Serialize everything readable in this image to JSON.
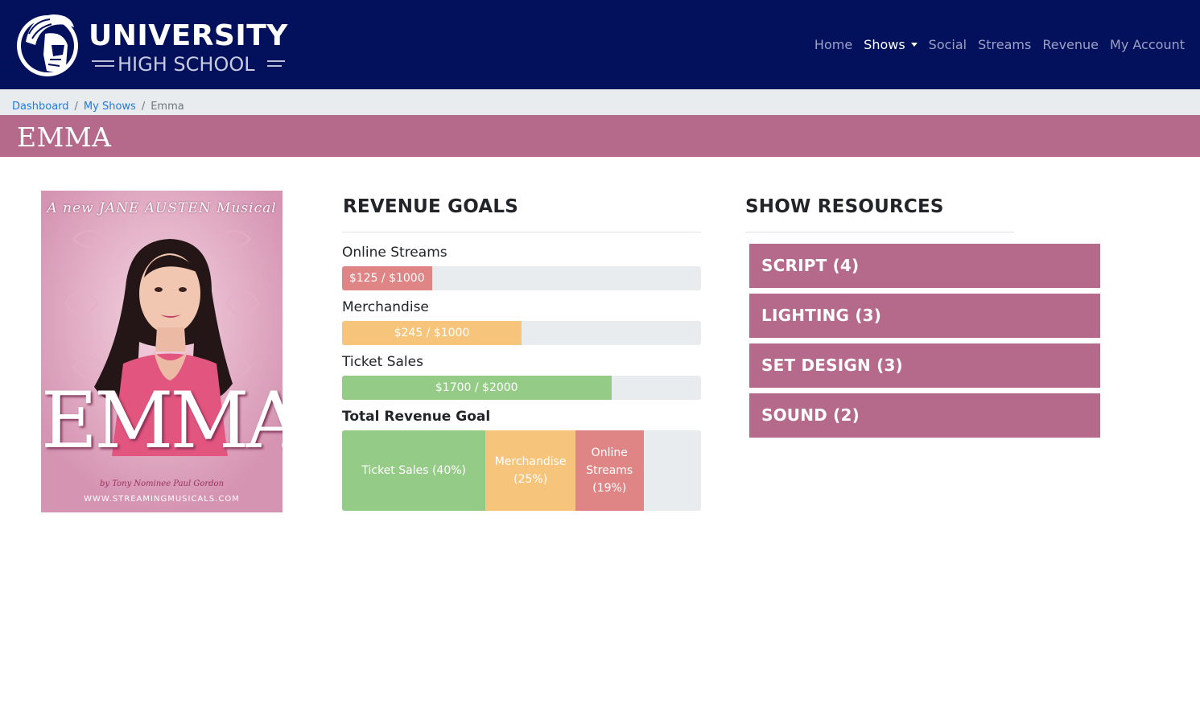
{
  "brand": {
    "line1": "UNIVERSITY",
    "line2": "HIGH SCHOOL",
    "emblem_icon": "spartan-helmet-icon"
  },
  "nav": {
    "items": [
      {
        "label": "Home",
        "active": false
      },
      {
        "label": "Shows",
        "active": true,
        "dropdown": true
      },
      {
        "label": "Social",
        "active": false
      },
      {
        "label": "Streams",
        "active": false
      },
      {
        "label": "Revenue",
        "active": false
      },
      {
        "label": "My Account",
        "active": false
      }
    ]
  },
  "breadcrumb": {
    "items": [
      "Dashboard",
      "My Shows"
    ],
    "current": "Emma",
    "separator": "/"
  },
  "page": {
    "title": "EMMA"
  },
  "poster": {
    "tagline": "A new JANE AUSTEN Musical",
    "title": "EMMA",
    "credit": "by Tony Nominee Paul Gordon",
    "url": "WWW.STREAMINGMUSICALS.COM"
  },
  "revenue": {
    "heading": "REVENUE GOALS",
    "goals": [
      {
        "label": "Online Streams",
        "bar_text": "$125 / $1000",
        "fraction": 0.25,
        "color": "#e08585"
      },
      {
        "label": "Merchandise",
        "bar_text": "$245 / $1000",
        "fraction": 0.5,
        "color": "#f6c57b"
      },
      {
        "label": "Ticket Sales",
        "bar_text": "$1700 / $2000",
        "fraction": 0.75,
        "color": "#94cb86"
      }
    ],
    "total": {
      "label": "Total Revenue Goal",
      "segments": [
        {
          "label": "Ticket Sales (40%)",
          "percent": 40,
          "color": "#94cb86"
        },
        {
          "label": "Merchandise (25%)",
          "percent": 25,
          "color": "#f6c57b"
        },
        {
          "label": "Online Streams (19%)",
          "percent": 19,
          "color": "#e08585"
        }
      ]
    }
  },
  "resources": {
    "heading": "SHOW RESOURCES",
    "items": [
      {
        "label": "SCRIPT (4)"
      },
      {
        "label": "LIGHTING (3)"
      },
      {
        "label": "SET DESIGN (3)"
      },
      {
        "label": "SOUND (2)"
      }
    ]
  },
  "colors": {
    "navbar": "#03105c",
    "accent": "#b56a8b",
    "breadcrumb_bg": "#e9ecef",
    "link": "#1e7ae0"
  }
}
